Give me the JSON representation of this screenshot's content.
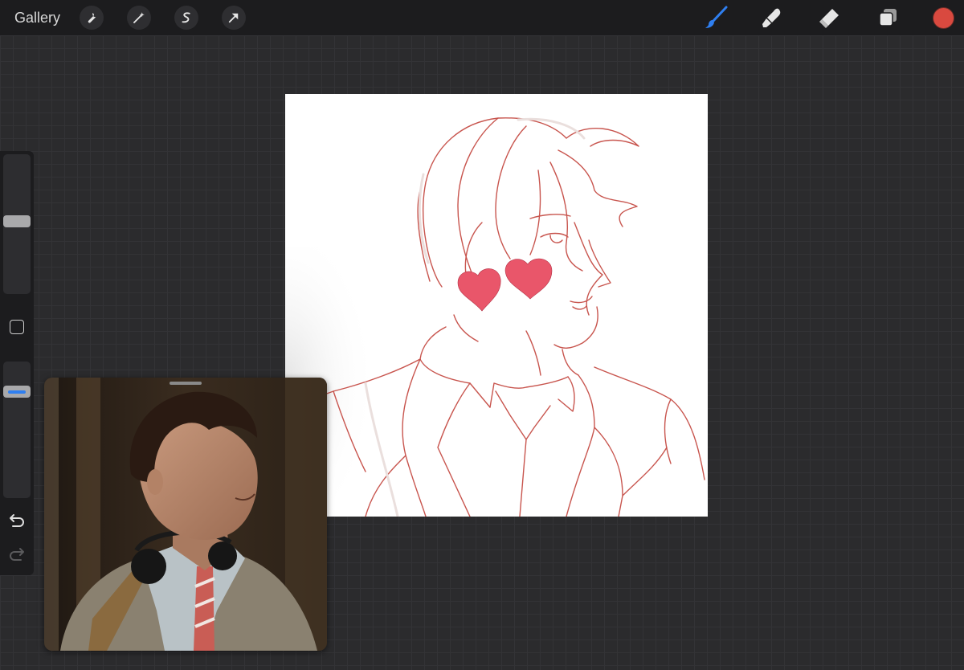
{
  "topbar": {
    "gallery_label": "Gallery",
    "left_tools": [
      "wrench-icon",
      "magic-wand-icon",
      "selection-icon",
      "transform-arrow-icon"
    ],
    "right_tools": [
      "brush-icon",
      "smudge-icon",
      "eraser-icon",
      "layers-icon"
    ],
    "active_tool": "brush-icon",
    "current_color": "#d9493f"
  },
  "sidebar": {
    "brush_size": 0.58,
    "brush_opacity": 0.8,
    "buttons": [
      "modify-square-icon",
      "undo-icon",
      "redo-icon"
    ]
  },
  "colors": {
    "accent_blue": "#2f7ff0",
    "line_art": "#c8554e",
    "heart_fill": "#e9566a"
  }
}
